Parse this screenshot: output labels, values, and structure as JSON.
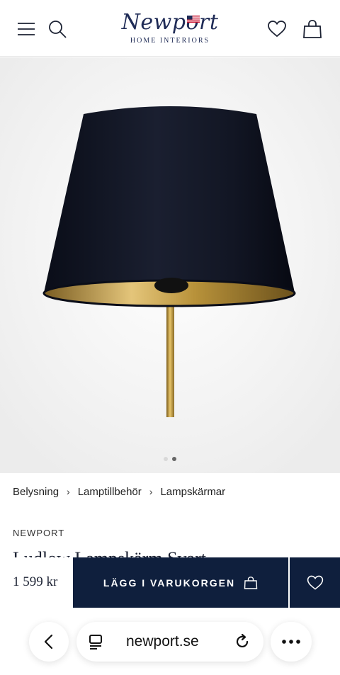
{
  "header": {
    "logo_text": "Newport",
    "logo_subtitle": "HOME INTERIORS",
    "icons": [
      "menu-icon",
      "search-icon",
      "heart-icon",
      "bag-icon"
    ]
  },
  "gallery": {
    "image_count": 2,
    "active_index": 1
  },
  "breadcrumb": [
    "Belysning",
    "Lamptillbehör",
    "Lampskärmar"
  ],
  "product": {
    "brand": "NEWPORT",
    "title": "Ludlow Lampskärm Svart",
    "price": "1 599 kr",
    "add_to_cart_label": "LÄGG I VARUKORGEN"
  },
  "browser": {
    "url": "newport.se"
  },
  "colors": {
    "navy": "#0f1f3d",
    "brand_blue": "#1f2b56",
    "gold": "#b8923a"
  }
}
